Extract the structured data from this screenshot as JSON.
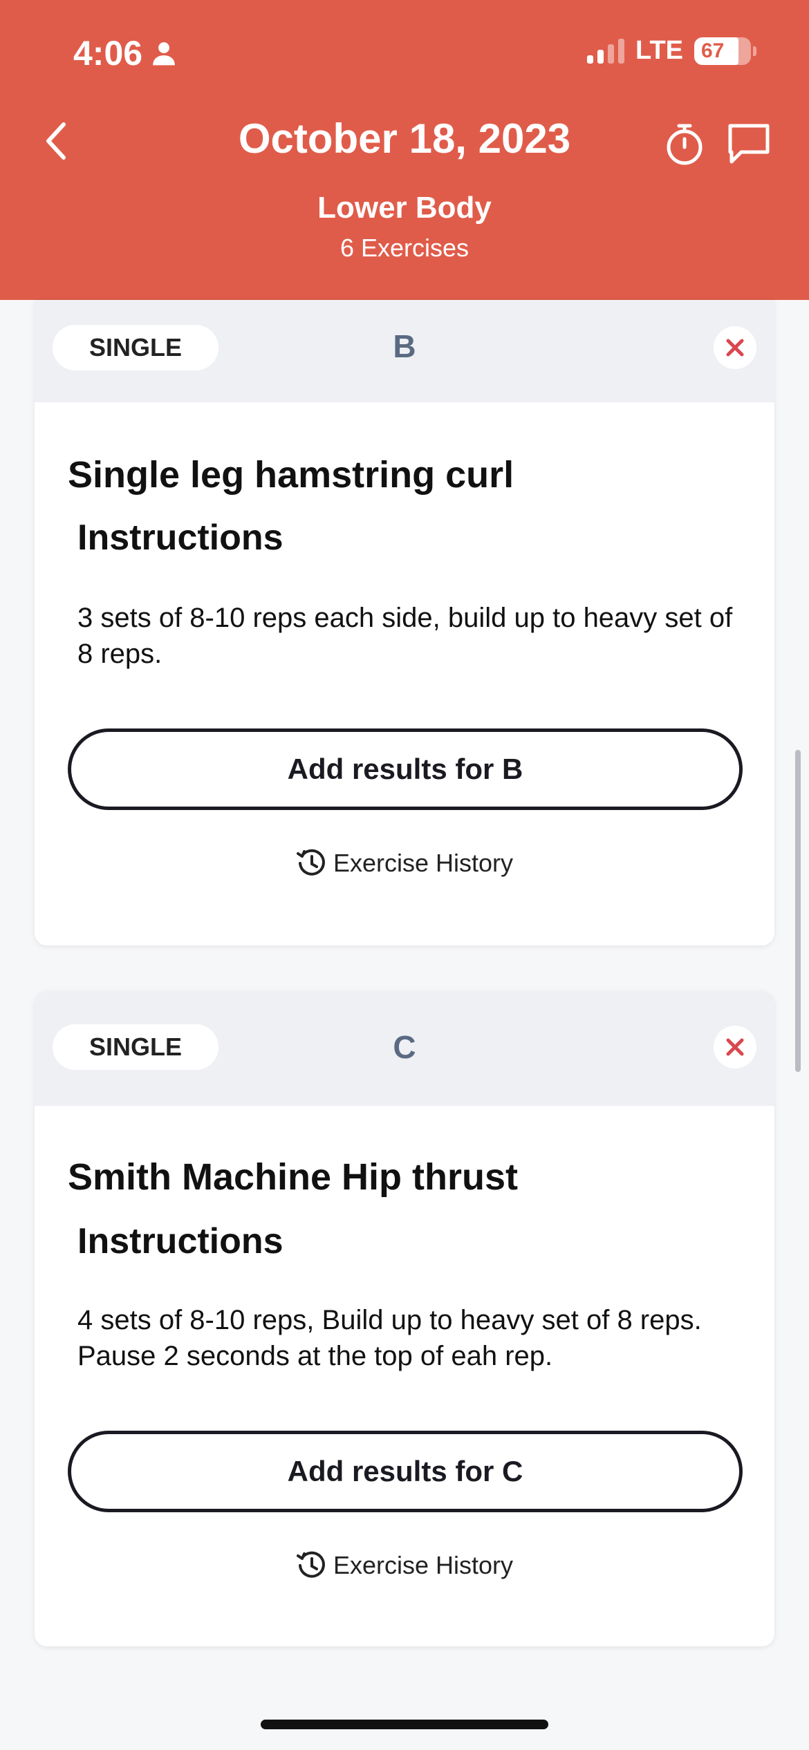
{
  "status_bar": {
    "time": "4:06",
    "network": "LTE",
    "battery": "67",
    "battery_level_percent": 67,
    "signal_bars_active": 2,
    "signal_bars_total": 4
  },
  "header": {
    "title": "October 18, 2023",
    "subtitle": "Lower Body",
    "exercise_count": "6 Exercises",
    "back_icon": "chevron-left-icon",
    "timer_icon": "stopwatch-icon",
    "chat_icon": "chat-bubble-icon",
    "background_color": "#e05c4a"
  },
  "exercises": [
    {
      "type": "SINGLE",
      "letter": "B",
      "name": "Single leg hamstring curl",
      "instructions_label": "Instructions",
      "instructions": "3 sets of 8-10 reps each side, build up to heavy set of 8 reps.",
      "add_results_label": "Add results for B",
      "history_label": "Exercise History"
    },
    {
      "type": "SINGLE",
      "letter": "C",
      "name": "Smith Machine Hip thrust",
      "instructions_label": "Instructions",
      "instructions": "4 sets of 8-10 reps, Build up to heavy set of 8 reps. Pause 2 seconds at the top of eah rep.",
      "add_results_label": "Add results for C",
      "history_label": "Exercise History"
    }
  ],
  "colors": {
    "accent": "#e05c4a",
    "close_icon": "#d9474f",
    "letter": "#5a6a82"
  }
}
